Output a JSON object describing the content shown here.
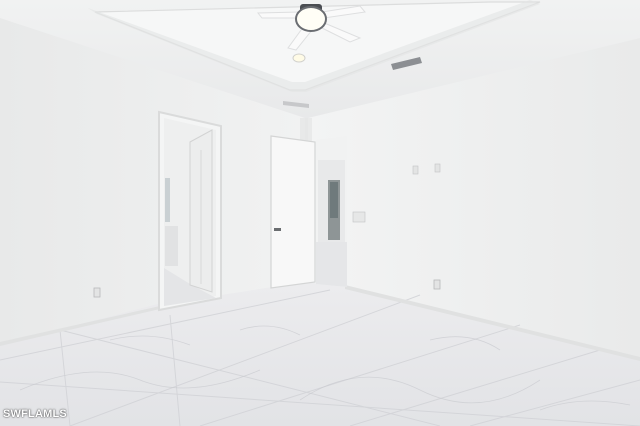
{
  "watermark": {
    "text": "SWFLAMLS"
  },
  "colors": {
    "wall": "#eff0f0",
    "ceiling": "#f2f3f3",
    "floor": "#e7e8ea",
    "door": "#f7f7f7",
    "fan_body": "#4a4d52"
  }
}
